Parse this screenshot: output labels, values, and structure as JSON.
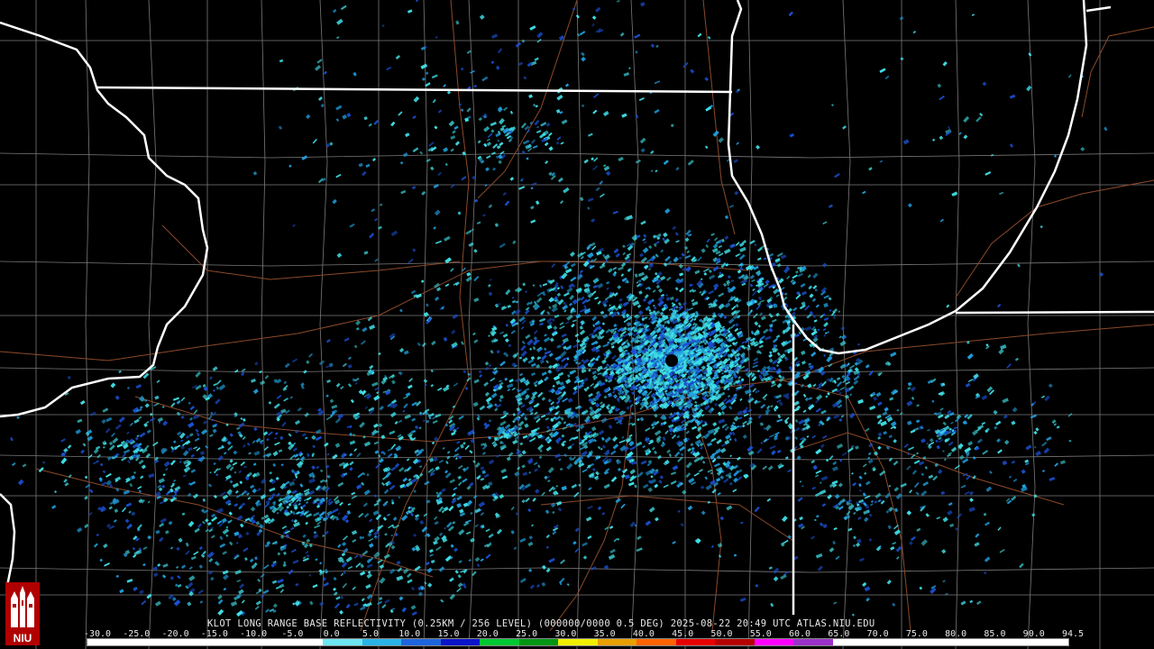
{
  "product_title": "KLOT LONG RANGE BASE REFLECTIVITY (0.25KM / 256 LEVEL) (000000/0000 0.5 DEG) 2025-08-22 20:49 UTC  ATLAS.NIU.EDU",
  "logo_text": "NIU",
  "colorbar": {
    "ticks": [
      "-30.0",
      "-25.0",
      "-20.0",
      "-15.0",
      "-10.0",
      "-5.0",
      "0.0",
      "5.0",
      "10.0",
      "15.0",
      "20.0",
      "25.0",
      "30.0",
      "35.0",
      "40.0",
      "45.0",
      "50.0",
      "55.0",
      "60.0",
      "65.0",
      "70.0",
      "75.0",
      "80.0",
      "85.0",
      "90.0",
      "94.5"
    ],
    "colors": [
      "#ffffff",
      "#ffffff",
      "#ffffff",
      "#ffffff",
      "#ffffff",
      "#ffffff",
      "#6ee6f0",
      "#2ab4e6",
      "#1e64dc",
      "#0a14c8",
      "#00c832",
      "#009614",
      "#f0f000",
      "#e6a000",
      "#ff6400",
      "#e60000",
      "#b40000",
      "#ff00ff",
      "#9b32c8",
      "#ffffff",
      "#ffffff",
      "#ffffff",
      "#ffffff",
      "#ffffff",
      "#ffffff"
    ]
  },
  "map_colors": {
    "background": "#000000",
    "state_border": "#ffffff",
    "county_line": "#7a7a7a",
    "highway": "#8b4a2a",
    "echo_light": "#40e0e8",
    "echo_mid": "#20a0e0",
    "echo_dark": "#1a50d0"
  },
  "radar_site": "KLOT"
}
